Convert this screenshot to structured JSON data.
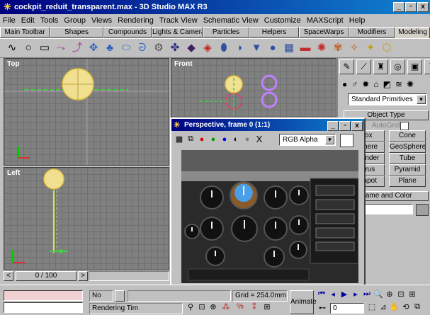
{
  "app": {
    "title": "cockpit_reduit_transparent.max - 3D Studio MAX R3",
    "window_buttons": [
      "_",
      "▫",
      "x"
    ]
  },
  "menu": [
    "File",
    "Edit",
    "Tools",
    "Group",
    "Views",
    "Rendering",
    "Track View",
    "Schematic View",
    "Customize",
    "MAXScript",
    "Help"
  ],
  "tabs": [
    "Main Toolbar",
    "Shapes",
    "Compounds",
    "Lights & Cameras",
    "Particles",
    "Helpers",
    "SpaceWarps",
    "Modifiers",
    "Modeling"
  ],
  "viewports": {
    "top": "Top",
    "front": "Front",
    "left": "Left"
  },
  "command_panel": {
    "category_dropdown": "Standard Primitives",
    "object_type_rollout": "Object Type",
    "autogrid_label": "AutoGrid",
    "primitives": [
      "Box",
      "Cone",
      "Sphere",
      "GeoSphere",
      "Cylinder",
      "Tube",
      "Torus",
      "Pyramid",
      "Teapot",
      "Plane"
    ],
    "name_color_rollout": "Name and Color"
  },
  "render_window": {
    "title": "Perspective, frame 0 (1:1)",
    "channel_dropdown": "RGB Alpha",
    "clear_label": "X"
  },
  "timeline": {
    "frame_counter": "0 / 100",
    "prev": "<",
    "next": ">"
  },
  "status": {
    "selection": "No",
    "lock_label": "",
    "grid": "Grid = 254.0mm",
    "prompt": "Rendering Tim",
    "animate": "Animate",
    "current_frame": "0"
  },
  "colors": {
    "title_start": "#00007f",
    "title_end": "#1084d0",
    "viewport_bg": "#808080",
    "panel_bg": "#c0c0c0"
  }
}
